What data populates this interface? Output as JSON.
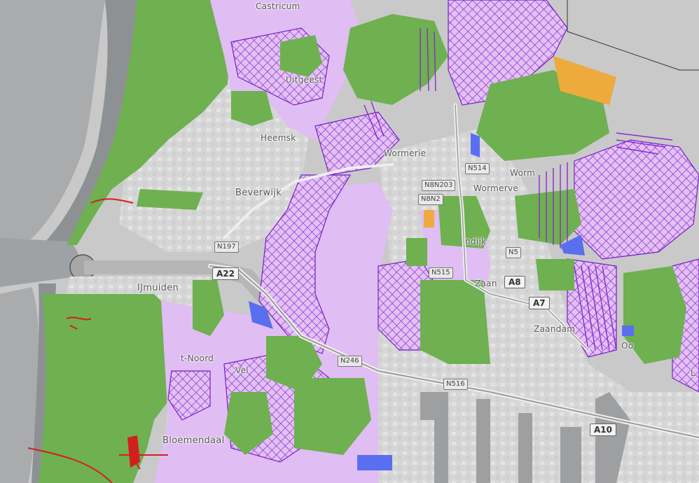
{
  "map": {
    "places": [
      {
        "id": "castricum",
        "name": "Castricum"
      },
      {
        "id": "uitgeest",
        "name": "Uitgeest"
      },
      {
        "id": "heemskerk",
        "name": "Heemsk"
      },
      {
        "id": "beverwijk",
        "name": "Beverwijk"
      },
      {
        "id": "wormerland",
        "name": "Wormerie"
      },
      {
        "id": "wormerveer",
        "name": "Wormerve"
      },
      {
        "id": "wormer",
        "name": "Worm"
      },
      {
        "id": "krommenie",
        "name": "ndijk"
      },
      {
        "id": "ijmuiden",
        "name": "IJmuiden"
      },
      {
        "id": "velsen",
        "name": "Vel"
      },
      {
        "id": "velsennoord",
        "name": "t-Noord"
      },
      {
        "id": "bloemendaal",
        "name": "Bloemendaal"
      },
      {
        "id": "zaan",
        "name": "Zaan"
      },
      {
        "id": "zaandam",
        "name": "Zaandam"
      },
      {
        "id": "oostzaan",
        "name": "Oo"
      },
      {
        "id": "landsmeer",
        "name": "L"
      }
    ],
    "road_shields": [
      {
        "id": "a22",
        "label": "A22",
        "kind": "motorway"
      },
      {
        "id": "a8",
        "label": "A8",
        "kind": "motorway"
      },
      {
        "id": "a7",
        "label": "A7",
        "kind": "motorway"
      },
      {
        "id": "a10",
        "label": "A10",
        "kind": "motorway"
      },
      {
        "id": "n197",
        "label": "N197",
        "kind": "provincial"
      },
      {
        "id": "n514",
        "label": "N514",
        "kind": "provincial"
      },
      {
        "id": "n8n203",
        "label": "N8N203",
        "kind": "provincial"
      },
      {
        "id": "n8n2",
        "label": "N8N2",
        "kind": "provincial"
      },
      {
        "id": "n516",
        "label": "N516",
        "kind": "provincial"
      },
      {
        "id": "n5",
        "label": "N5",
        "kind": "provincial"
      },
      {
        "id": "n515",
        "label": "N515",
        "kind": "provincial"
      },
      {
        "id": "n246",
        "label": "N246",
        "kind": "provincial"
      }
    ],
    "colors": {
      "sea": "#a6a9ab",
      "land": "#c9c9c9",
      "urban": "#dcdcdc",
      "nature_green": "#6fb051",
      "protected_lilac": "#e0bdf3",
      "hatch_purple": "#8a2bd0",
      "orange": "#eeaa3c",
      "blue": "#5a6ef0",
      "red": "#d41f1f"
    }
  }
}
